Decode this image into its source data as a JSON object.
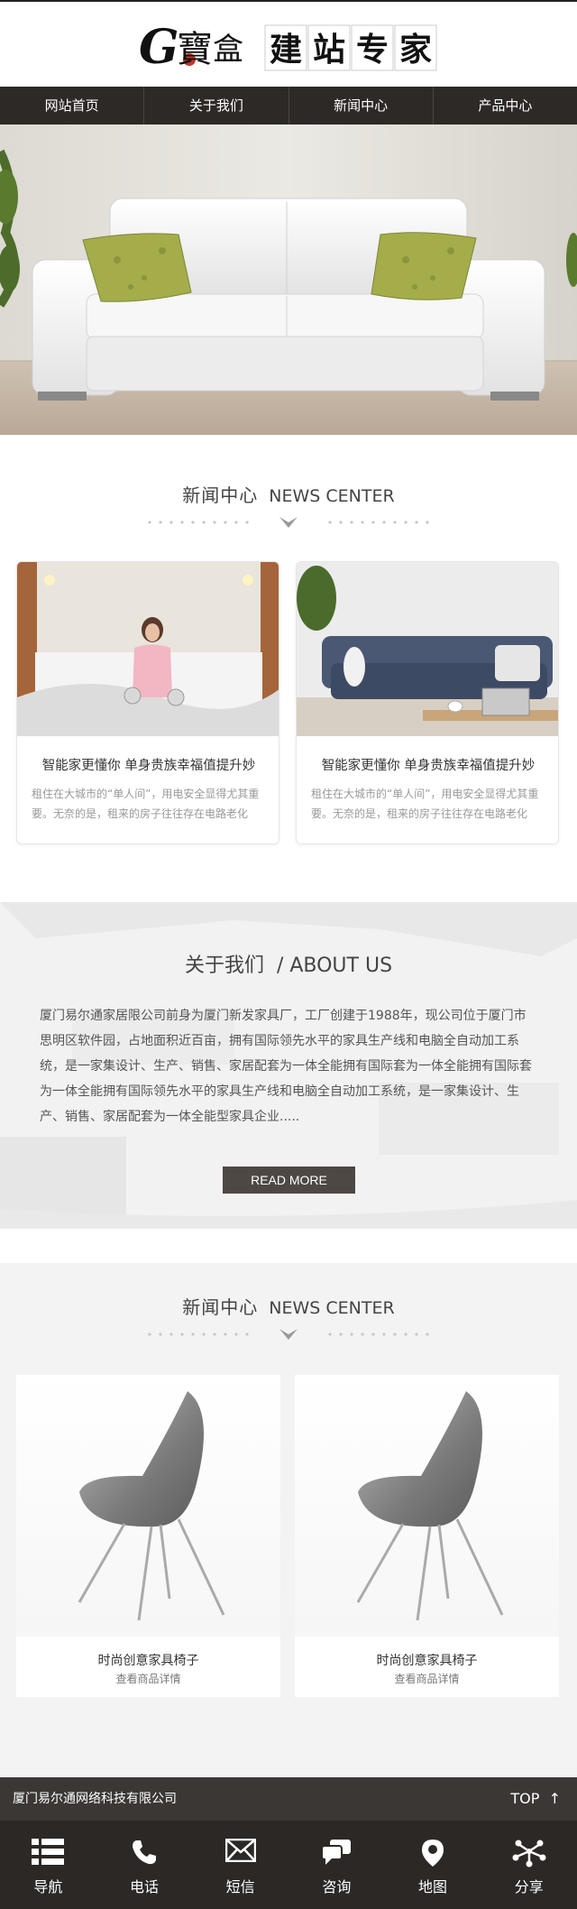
{
  "header": {
    "logo_brand": "G寶盒",
    "logo_tagline": "建站专家"
  },
  "nav": {
    "items": [
      {
        "label": "网站首页"
      },
      {
        "label": "关于我们"
      },
      {
        "label": "新闻中心"
      },
      {
        "label": "产品中心"
      }
    ]
  },
  "news": {
    "title": "新闻中心",
    "title_en": "NEWS CENTER",
    "items": [
      {
        "title": "智能家更懂你 单身贵族幸福值提升妙",
        "summary": "租住在大城市的“单人间”，用电安全显得尤其重要。无奈的是，租来的房子往往存在电路老化"
      },
      {
        "title": "智能家更懂你 单身贵族幸福值提升妙",
        "summary": "租住在大城市的“单人间”，用电安全显得尤其重要。无奈的是，租来的房子往往存在电路老化"
      }
    ]
  },
  "about": {
    "title": "关于我们",
    "title_en": "/ ABOUT US",
    "body": "厦门易尔通家居限公司前身为厦门新发家具厂，工厂创建于1988年，现公司位于厦门市思明区软件园，占地面积近百亩，拥有国际领先水平的家具生产线和电脑全自动加工系统，是一家集设计、生产、销售、家居配套为一体全能拥有国际套为一体全能拥有国际套为一体全能拥有国际领先水平的家具生产线和电脑全自动加工系统，是一家集设计、生产、销售、家居配套为一体全能型家具企业.....",
    "more_label": "READ MORE"
  },
  "products": {
    "title": "新闻中心",
    "title_en": "NEWS CENTER",
    "items": [
      {
        "name": "时尚创意家具椅子",
        "link": "查看商品详情"
      },
      {
        "name": "时尚创意家具椅子",
        "link": "查看商品详情"
      }
    ]
  },
  "footer": {
    "company": "厦门易尔通网络科技有限公司",
    "top_label": "TOP"
  },
  "toolbar": {
    "items": [
      {
        "label": "导航",
        "icon": "menu-icon"
      },
      {
        "label": "电话",
        "icon": "phone-icon"
      },
      {
        "label": "短信",
        "icon": "mail-icon"
      },
      {
        "label": "咨询",
        "icon": "chat-icon"
      },
      {
        "label": "地图",
        "icon": "map-pin-icon"
      },
      {
        "label": "分享",
        "icon": "share-icon"
      }
    ]
  },
  "colors": {
    "nav_bg": "#2d2926",
    "footer_bg": "#3b3735",
    "toolbar_bg": "#2b2826",
    "button_bg": "#4e4845"
  }
}
